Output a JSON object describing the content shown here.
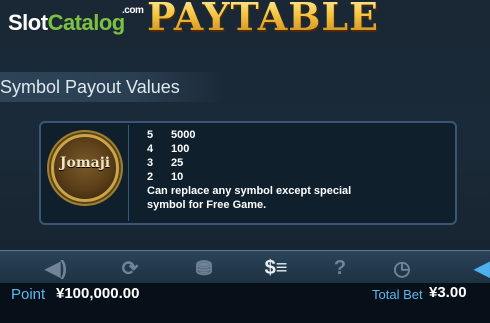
{
  "watermark": {
    "slot": "Slot",
    "catalog": "Catalog",
    "com": ".com"
  },
  "title": "PAYTABLE",
  "section": {
    "title": "Symbol Payout Values"
  },
  "symbol": {
    "name": "Jomaji",
    "payouts": [
      {
        "count": "5",
        "value": "5000"
      },
      {
        "count": "4",
        "value": "100"
      },
      {
        "count": "3",
        "value": "25"
      },
      {
        "count": "2",
        "value": "10"
      }
    ],
    "description_line1": "Can replace any symbol except special",
    "description_line2": "symbol for Free Game."
  },
  "toolbar": {
    "icons": [
      {
        "name": "sound-icon",
        "glyph": "◀)"
      },
      {
        "name": "autoplay-icon",
        "glyph": "⟳"
      },
      {
        "name": "coins-icon",
        "glyph": "⛃"
      },
      {
        "name": "paytable-icon",
        "glyph": "$≡"
      },
      {
        "name": "help-icon",
        "glyph": "?"
      },
      {
        "name": "history-icon",
        "glyph": "◷"
      },
      {
        "name": "back-icon",
        "glyph": "◀"
      }
    ]
  },
  "status": {
    "point_label": "Point",
    "point_value": "¥100,000.00",
    "bet_label": "Total Bet",
    "bet_value": "¥3.00"
  },
  "colors": {
    "accent_blue": "#5fb7f0",
    "title_gold": "#f5c542",
    "card_border": "#3a5576"
  }
}
